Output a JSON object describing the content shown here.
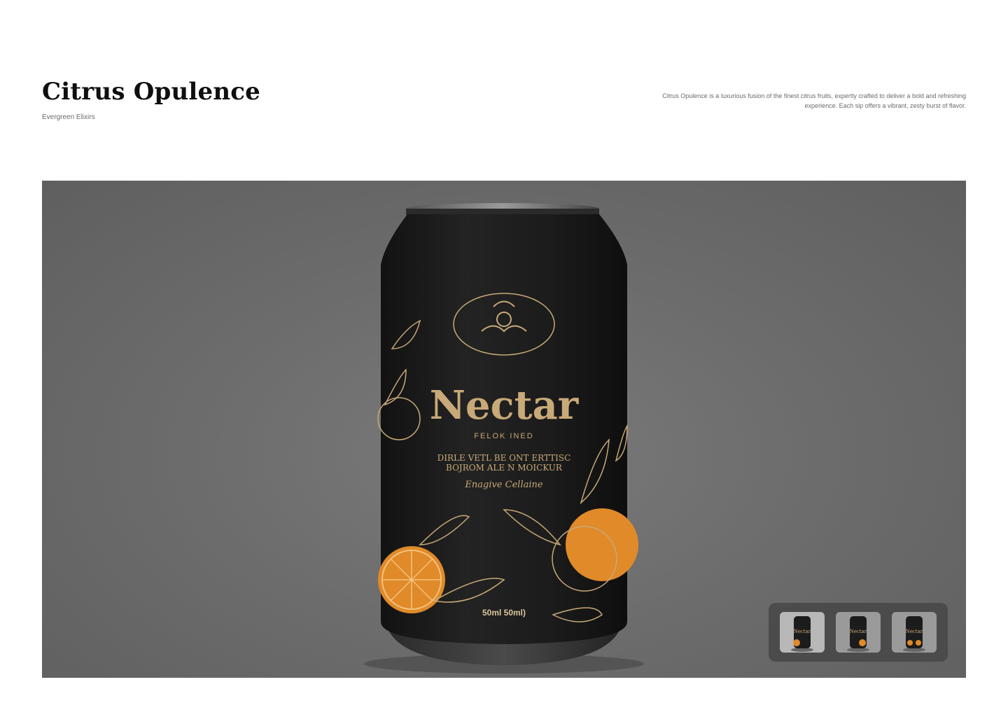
{
  "header": {
    "title": "Citrus Opulence",
    "subtitle": "Evergreen Elixirs",
    "description": "Citrus Opulence is a luxurious fusion of the finest citrus fruits, expertly crafted to deliver a bold and refreshing experience. Each sip offers a vibrant, zesty burst of flavor."
  },
  "product": {
    "brand_name": "Nectar",
    "label_line1": "FELOK INED",
    "label_line2": "DIRLE VETL BE ONT ERTTISC",
    "label_line3": "BOJROM ALE N MOICKUR",
    "label_script": "Enagive Cellaine",
    "volume": "50ml 50ml)"
  },
  "thumbnails": [
    {
      "label": "Nectar",
      "selected": true
    },
    {
      "label": "Nectar",
      "selected": false
    },
    {
      "label": "Nectar",
      "selected": false
    }
  ],
  "colors": {
    "can_body": "#1c1c1c",
    "gold": "#c8a978",
    "orange": "#e08a2a",
    "background": "#6d6d6d"
  }
}
